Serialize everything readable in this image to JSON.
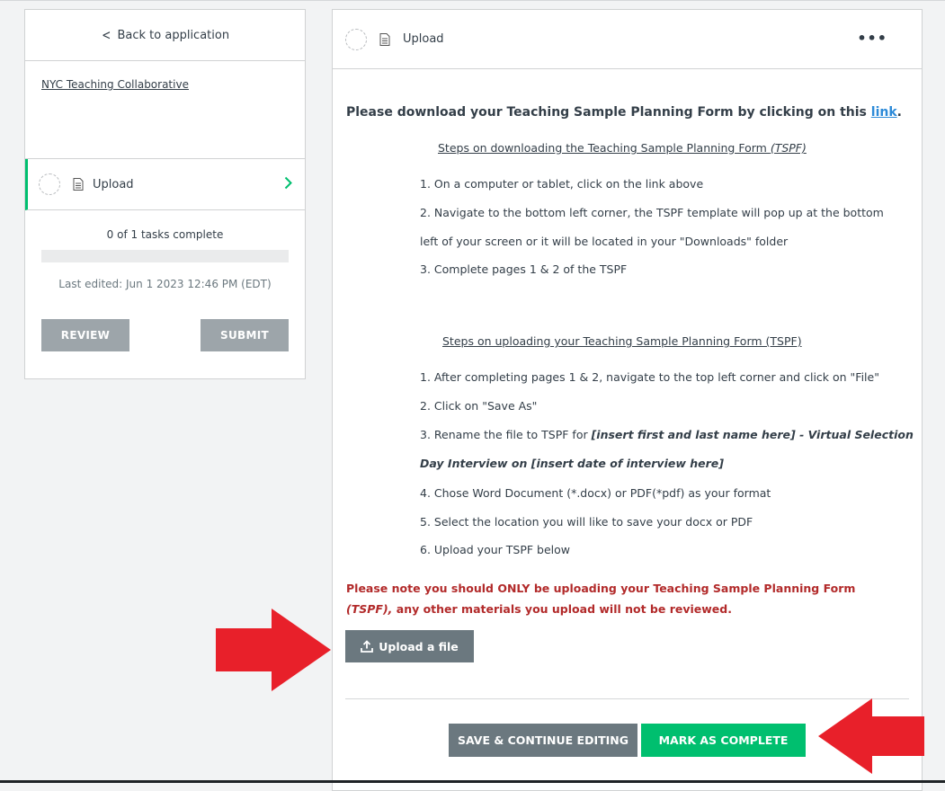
{
  "sidebar": {
    "back_label": "Back to application",
    "org_name": "NYC Teaching Collaborative",
    "task": {
      "label": "Upload"
    },
    "progress_text": "0 of 1 tasks complete",
    "progress_fraction": 0,
    "last_edited": "Last edited: Jun 1 2023 12:46 PM (EDT)",
    "review_label": "REVIEW",
    "submit_label": "SUBMIT"
  },
  "main": {
    "header_title": "Upload",
    "more_label": "•••",
    "intro_prefix": "Please download your Teaching Sample Planning Form by clicking on this ",
    "intro_link": "link",
    "intro_suffix": ".",
    "download_heading": "Steps on downloading the Teaching Sample Planning Form ",
    "download_heading_italic": "(TSPF)",
    "download_steps": [
      "1. On a computer or tablet, click on the link above",
      "2. Navigate to the bottom left corner, the TSPF template will pop up at the bottom",
      "left of your screen or it will be located in your \"Downloads\" folder",
      "3. Complete pages 1 & 2 of the TSPF"
    ],
    "upload_heading": "Steps on uploading your Teaching Sample Planning Form (TSPF)",
    "upload_steps": {
      "s1": "1. After completing pages 1 & 2, navigate to the top left corner and click on \"File\"",
      "s2": "2. Click on \"Save As\"",
      "s3_prefix": "3. Rename the file to TSPF for ",
      "s3_bold": "[insert first and last name here] - Virtual Selection",
      "s3_cont": "Day Interview on [insert date of interview here]",
      "s4": "4. Chose Word Document (*.docx) or  PDF(*pdf) as your format",
      "s5": "5. Select the location you will like to save your docx or PDF",
      "s6": "6. Upload your TSPF below"
    },
    "warning_prefix": "Please note you should ONLY be uploading your Teaching Sample Planning Form ",
    "warning_italic": "(TSPF),",
    "warning_suffix": " any other materials you upload will not be reviewed.",
    "upload_button": "Upload a file",
    "save_button": "SAVE & CONTINUE EDITING",
    "complete_button": "MARK AS COMPLETE"
  },
  "colors": {
    "accent_green": "#00bf6f",
    "annotation_red": "#e8202a",
    "warning_red": "#b22a2a",
    "link_blue": "#2c8ad8"
  }
}
